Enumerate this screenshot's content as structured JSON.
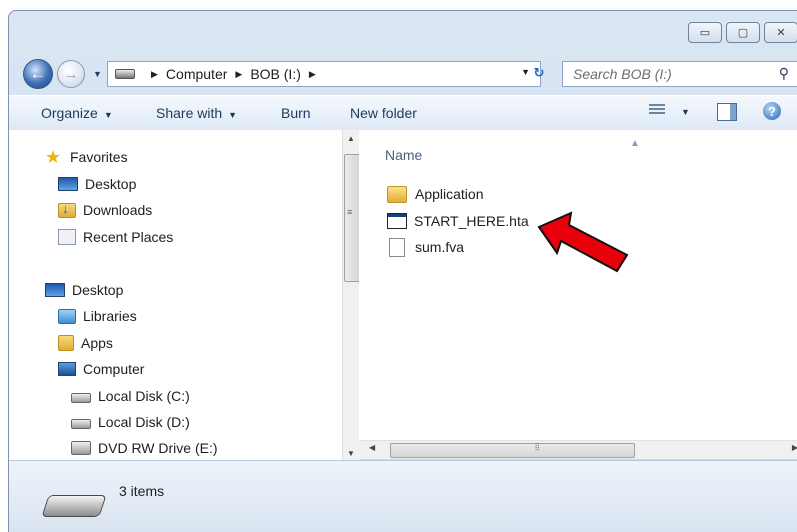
{
  "window": {
    "buttons": [
      "minimize",
      "maximize",
      "close"
    ]
  },
  "address": {
    "segments": [
      "Computer",
      "BOB (I:)"
    ],
    "search_placeholder": "Search BOB (I:)"
  },
  "toolbar": {
    "organize": "Organize",
    "share_with": "Share with",
    "burn": "Burn",
    "new_folder": "New folder"
  },
  "nav": {
    "items": [
      {
        "label": "Favorites",
        "icon": "star-icon"
      },
      {
        "label": "Desktop",
        "icon": "desktop-icon"
      },
      {
        "label": "Downloads",
        "icon": "downloads-folder-icon"
      },
      {
        "label": "Recent Places",
        "icon": "recent-places-icon"
      },
      {
        "label": "Desktop",
        "icon": "desktop-icon"
      },
      {
        "label": "Libraries",
        "icon": "libraries-icon"
      },
      {
        "label": "Apps",
        "icon": "apps-folder-icon"
      },
      {
        "label": "Computer",
        "icon": "computer-icon"
      },
      {
        "label": "Local Disk (C:)",
        "icon": "local-disk-icon"
      },
      {
        "label": "Local Disk (D:)",
        "icon": "local-disk-icon"
      },
      {
        "label": "DVD RW Drive (E:)",
        "icon": "dvd-drive-icon"
      }
    ]
  },
  "content": {
    "column_header": "Name",
    "files": [
      {
        "name": "Application",
        "icon": "folder-icon"
      },
      {
        "name": "START_HERE.hta",
        "icon": "hta-file-icon"
      },
      {
        "name": "sum.fva",
        "icon": "generic-file-icon"
      }
    ]
  },
  "status": {
    "item_count": "3 items"
  },
  "annotation": {
    "arrow_color": "#e8000b"
  }
}
